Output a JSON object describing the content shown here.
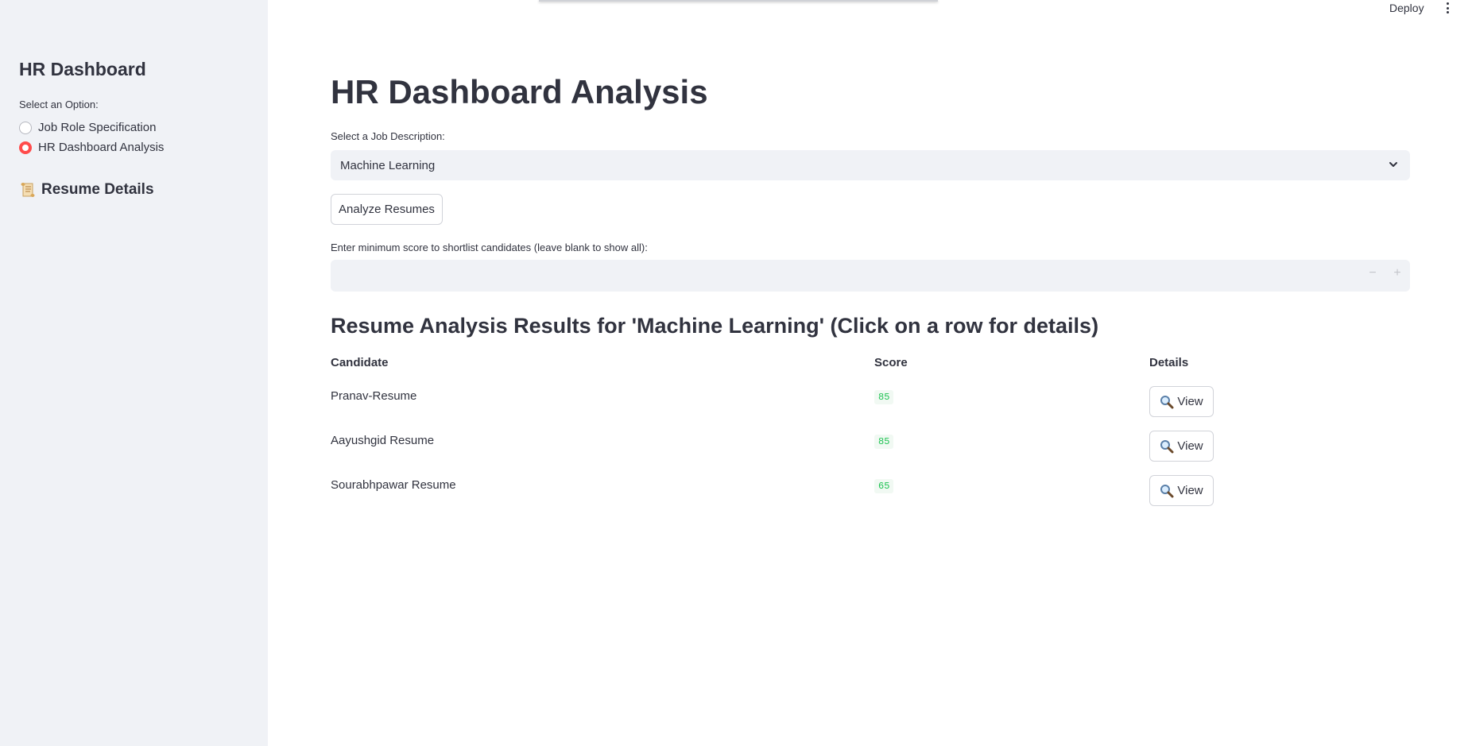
{
  "sidebar": {
    "title": "HR Dashboard",
    "select_label": "Select an Option:",
    "options": [
      {
        "label": "Job Role Specification",
        "selected": false
      },
      {
        "label": "HR Dashboard Analysis",
        "selected": true
      }
    ],
    "section": {
      "icon": "scroll-icon",
      "label": "Resume Details"
    }
  },
  "topbar": {
    "deploy_label": "Deploy",
    "menu_icon": "kebab-menu-icon"
  },
  "main": {
    "title": "HR Dashboard Analysis",
    "job_select": {
      "label": "Select a Job Description:",
      "value": "Machine Learning",
      "icon": "chevron-down-icon"
    },
    "analyze_button": "Analyze Resumes",
    "min_score": {
      "label": "Enter minimum score to shortlist candidates (leave blank to show all):",
      "value": "",
      "placeholder": "",
      "minus": "−",
      "plus": "+"
    },
    "results_title": "Resume Analysis Results for 'Machine Learning' (Click on a row for details)",
    "table": {
      "headers": [
        "Candidate",
        "Score",
        "Details"
      ],
      "rows": [
        {
          "candidate": "Pranav-Resume",
          "score": "85",
          "action": "View"
        },
        {
          "candidate": "Aayushgid Resume",
          "score": "85",
          "action": "View"
        },
        {
          "candidate": "Sourabhpawar Resume",
          "score": "65",
          "action": "View"
        }
      ]
    }
  },
  "colors": {
    "accent": "#ff4b4b",
    "sidebar_bg": "#f0f2f6",
    "score_green": "#21c354"
  }
}
